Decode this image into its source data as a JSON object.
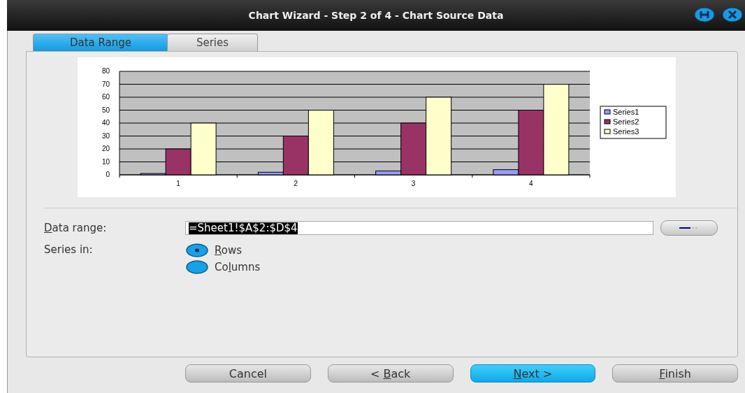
{
  "window": {
    "title": "Chart Wizard - Step 2 of 4 - Chart Source Data"
  },
  "tabs": [
    {
      "label": "Data Range",
      "selected": true
    },
    {
      "label": "Series",
      "selected": false
    }
  ],
  "chart": {
    "chart_data": {
      "type": "bar",
      "grid": true,
      "legend": true,
      "categories": [
        "1",
        "2",
        "3",
        "4"
      ],
      "ylim": [
        0,
        80
      ],
      "yticks": [
        0,
        10,
        20,
        30,
        40,
        50,
        60,
        70,
        80
      ],
      "series": [
        {
          "name": "Series1",
          "color": "#9999ff",
          "values": [
            1,
            2,
            3,
            4
          ]
        },
        {
          "name": "Series2",
          "color": "#993366",
          "values": [
            20,
            30,
            40,
            50
          ]
        },
        {
          "name": "Series3",
          "color": "#ffffcc",
          "values": [
            40,
            50,
            60,
            70
          ]
        }
      ]
    }
  },
  "data_range": {
    "access_key": "D",
    "label_end": "ata range:",
    "value": "=Sheet1!$A$2:$D$4"
  },
  "series_in": {
    "label": "Series in:",
    "options": [
      {
        "access_key": "R",
        "label_end": "ows",
        "selected": true
      },
      {
        "label_start": "Co",
        "access_key": "l",
        "label_end": "umns",
        "selected": false
      }
    ]
  },
  "buttons": [
    {
      "label": "Cancel",
      "default": false
    },
    {
      "label_start": "< ",
      "access_key": "B",
      "label_end": "ack",
      "default": false
    },
    {
      "access_key": "N",
      "label_end": "ext >",
      "default": true
    },
    {
      "access_key": "F",
      "label_end": "inish",
      "default": false
    }
  ]
}
